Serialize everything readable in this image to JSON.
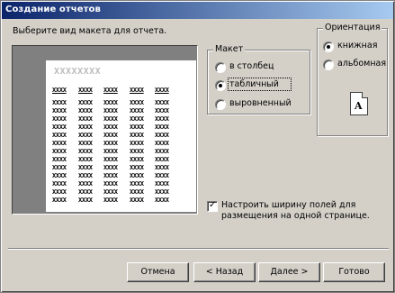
{
  "window": {
    "title": "Создание отчетов"
  },
  "instruction": "Выберите вид макета для отчета.",
  "preview": {
    "title": "XXXXXXXX",
    "header_cells": [
      "XXXX",
      "XXXX",
      "XXXX",
      "XXXX",
      "XXXX"
    ],
    "cell_text": "XXXX"
  },
  "layout_group": {
    "label": "Макет",
    "options": [
      {
        "label": "в столбец",
        "selected": false
      },
      {
        "label": "табличный",
        "selected": true
      },
      {
        "label": "выровненный",
        "selected": false
      }
    ]
  },
  "orientation_group": {
    "label": "Ориентация",
    "options": [
      {
        "label": "книжная",
        "selected": true
      },
      {
        "label": "альбомная",
        "selected": false
      }
    ],
    "icon_letter": "A"
  },
  "fit_width": {
    "checked": true,
    "label": "Настроить ширину полей для размещения на одной странице."
  },
  "buttons": {
    "cancel": "Отмена",
    "back": "< Назад",
    "next": "Далее >",
    "finish": "Готово"
  }
}
